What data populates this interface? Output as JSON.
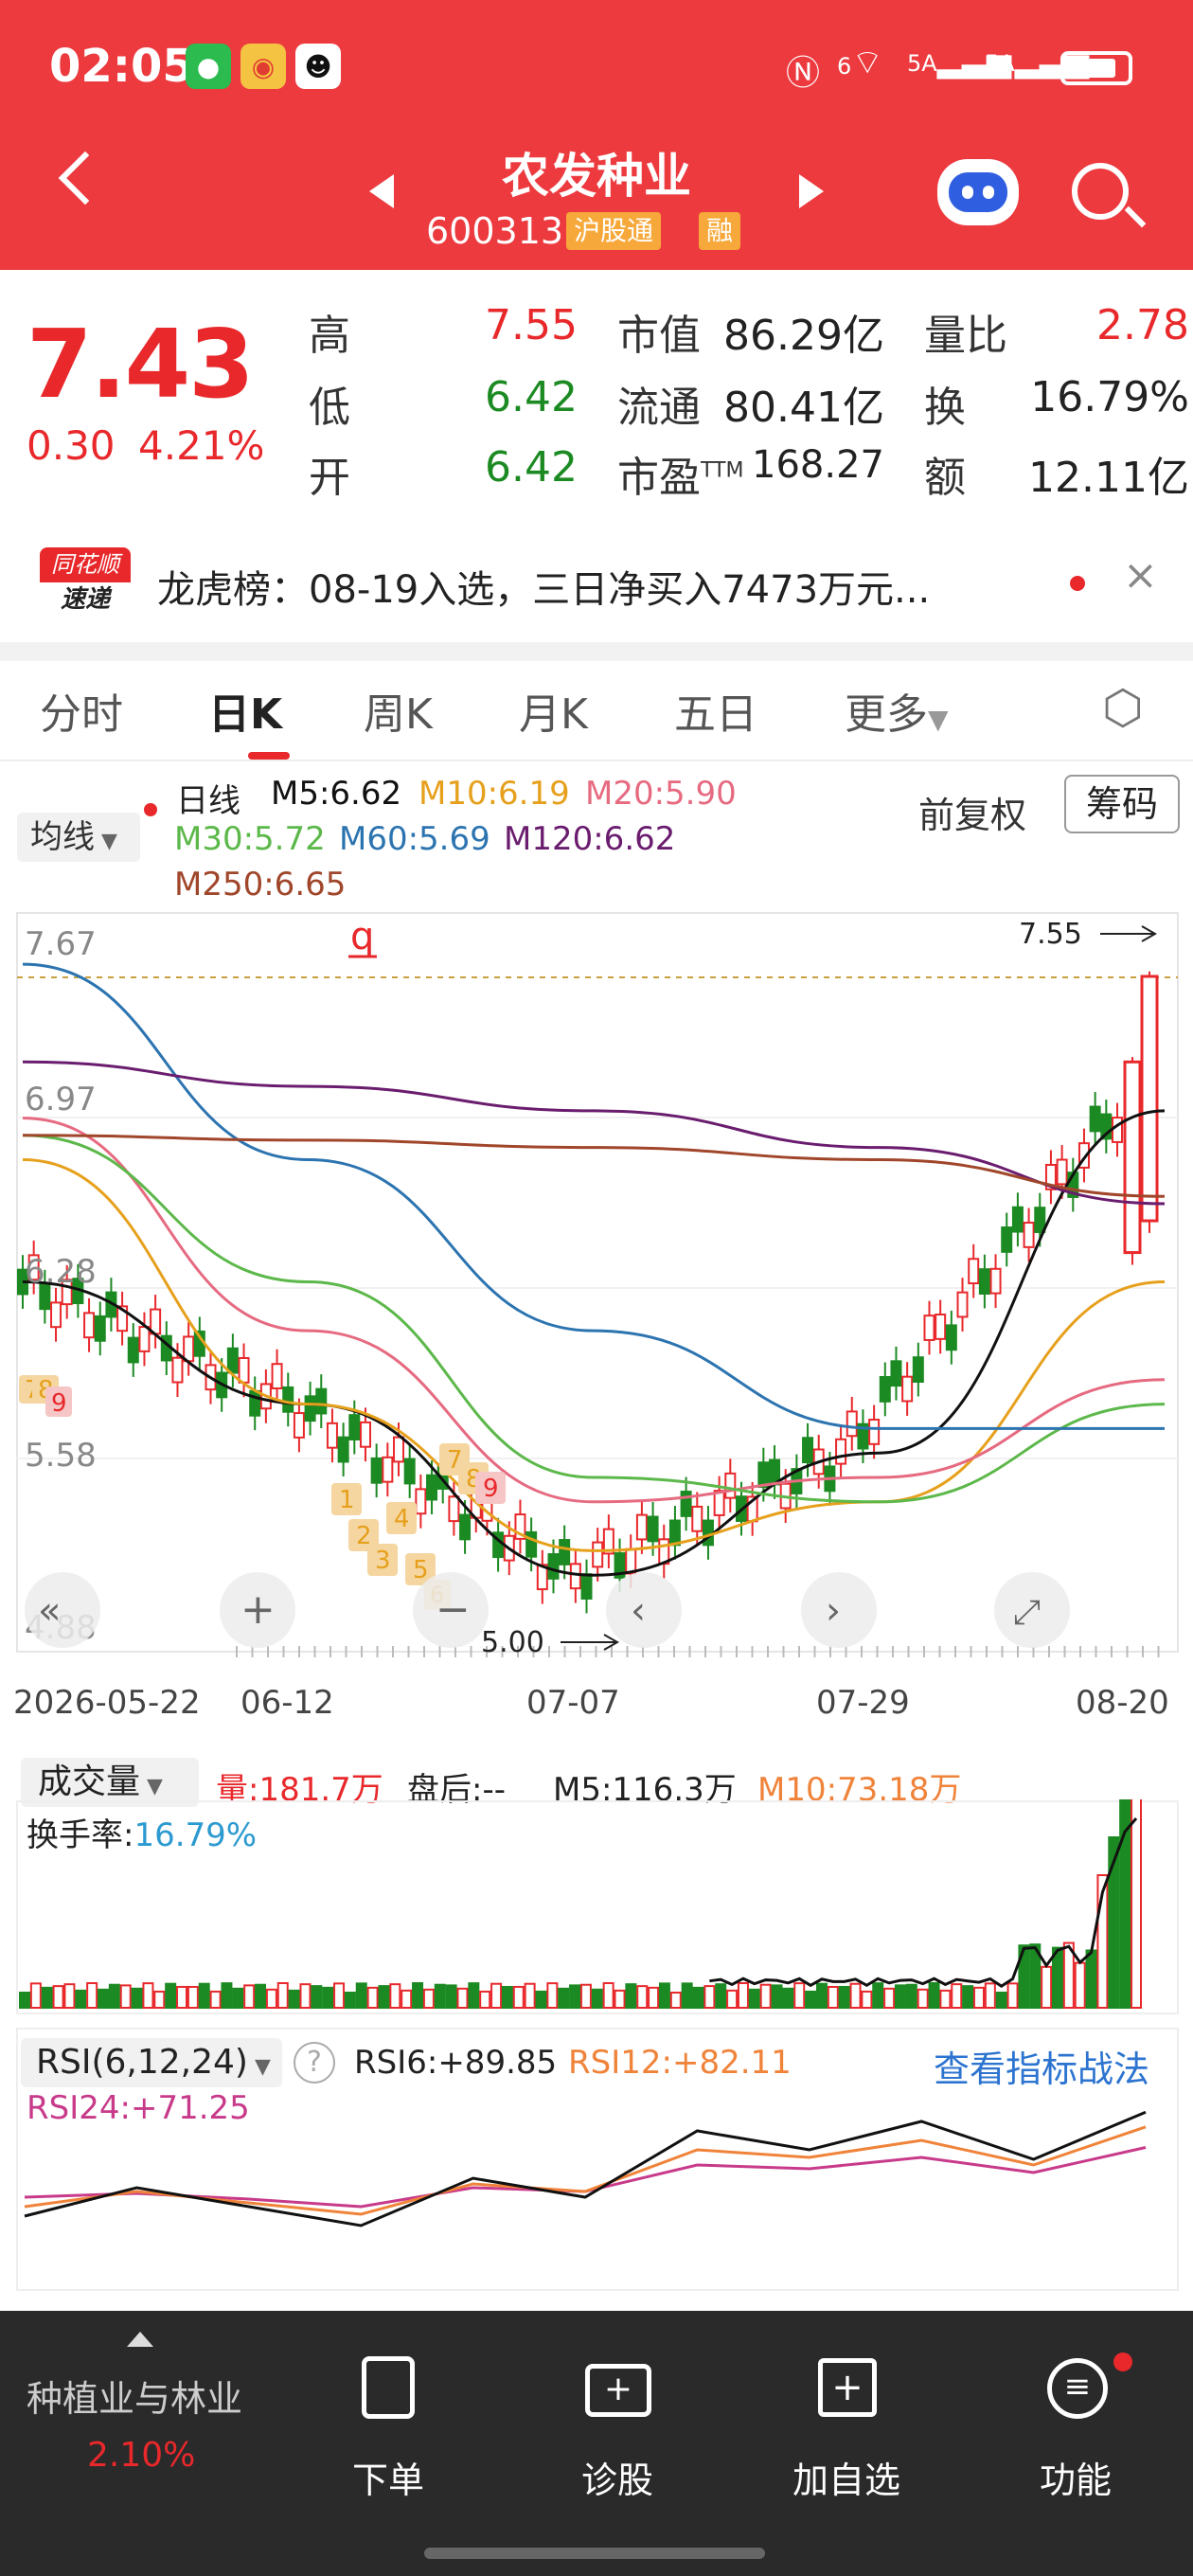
{
  "status_bar": {
    "time": "02:05",
    "wifi_label": "6",
    "signal1_label": "5A",
    "signal2_label": "5A"
  },
  "title_bar": {
    "name": "农发种业",
    "code": "600313",
    "tag1": "沪股通",
    "tag2": "融"
  },
  "quote": {
    "price": "7.43",
    "change": "0.30",
    "change_pct": "4.21%",
    "high_label": "高",
    "high": "7.55",
    "low_label": "低",
    "low": "6.42",
    "open_label": "开",
    "open": "6.42",
    "mktcap_label": "市值",
    "mktcap": "86.29亿",
    "float_label": "流通",
    "float": "80.41亿",
    "pe_label": "市盈",
    "pe_sup": "TTM",
    "pe": "168.27",
    "volratio_label": "量比",
    "volratio": "2.78",
    "turnover_label": "换",
    "turnover": "16.79%",
    "amount_label": "额",
    "amount": "12.11亿"
  },
  "news": {
    "logo_top": "同花顺",
    "logo_bottom": "速递",
    "text": "龙虎榜：08-19入选，三日净买入7473万元..."
  },
  "tabs": [
    "分时",
    "日K",
    "周K",
    "月K",
    "五日",
    "更多"
  ],
  "kline": {
    "ma_button": "均线",
    "ma_line1": {
      "day": "日线",
      "m5": "M5:6.62",
      "m10": "M10:6.19",
      "m20": "M20:5.90"
    },
    "ma_line2": {
      "m30": "M30:5.72",
      "m60": "M60:5.69",
      "m120": "M120:6.62"
    },
    "ma_line3": {
      "m250": "M250:6.65"
    },
    "adjust": "前复权",
    "chips": "筹码",
    "y_ticks": [
      "7.67",
      "6.97",
      "6.28",
      "5.58",
      "4.88"
    ],
    "high_mark": "7.55",
    "low_mark": "5.00",
    "dates": [
      "2026-05-22",
      "06-12",
      "07-07",
      "07-29",
      "08-20"
    ],
    "q_marker": "q",
    "td_labels_upper": [
      "7",
      "8",
      "9"
    ],
    "td_labels_lower": [
      "1",
      "2",
      "3",
      "4",
      "5",
      "6"
    ],
    "td_labels_left": [
      "7",
      "8",
      "9"
    ]
  },
  "volume": {
    "label": "成交量",
    "vol": "量:181.7万",
    "after": "盘后:-- ",
    "m5": "M5:116.3万",
    "m10": "M10:73.18万",
    "turnover_label": "换手率:",
    "turnover": "16.79%"
  },
  "rsi": {
    "label": "RSI(6,12,24)",
    "help": "?",
    "rsi6": "RSI6:+89.85",
    "rsi12": "RSI12:+82.11",
    "rsi24": "RSI24:+71.25",
    "link": "查看指标战法"
  },
  "bottom": {
    "sector": "种植业与林业",
    "sector_pct": "2.10%",
    "items": [
      "下单",
      "诊股",
      "加自选",
      "功能"
    ]
  },
  "colors": {
    "header": "#ec3a3f",
    "up": "#e8282b",
    "down": "#1c8a22",
    "m5": "#111111",
    "m10": "#e6a01c",
    "m20": "#e66a80",
    "m30": "#5cb84a",
    "m60": "#2c74b0",
    "m120": "#6a1c6e",
    "m250": "#a0462a"
  },
  "chart_data": [
    {
      "type": "line",
      "title": "",
      "x": [
        "2026-05-22",
        "06-12",
        "07-07",
        "07-29",
        "08-20"
      ],
      "ylim": [
        4.88,
        7.67
      ],
      "series": [
        {
          "name": "M5",
          "values": [
            6.3,
            5.8,
            5.1,
            5.6,
            7.0
          ]
        },
        {
          "name": "M10",
          "values": [
            6.8,
            5.8,
            5.2,
            5.4,
            6.3
          ]
        },
        {
          "name": "M20",
          "values": [
            6.97,
            6.1,
            5.4,
            5.5,
            5.9
          ]
        },
        {
          "name": "M30",
          "values": [
            6.9,
            6.3,
            5.5,
            5.4,
            5.8
          ]
        },
        {
          "name": "M60",
          "values": [
            7.6,
            6.8,
            6.1,
            5.7,
            5.7
          ]
        },
        {
          "name": "M120",
          "values": [
            7.2,
            7.1,
            7.0,
            6.85,
            6.62
          ]
        },
        {
          "name": "M250",
          "values": [
            6.9,
            6.88,
            6.85,
            6.8,
            6.65
          ]
        }
      ]
    },
    {
      "type": "line",
      "title": "",
      "series": [
        {
          "name": "RSI6",
          "values": [
            35,
            50,
            40,
            30,
            55,
            45,
            80,
            70,
            85,
            65,
            89.85
          ]
        },
        {
          "name": "RSI12",
          "values": [
            40,
            48,
            42,
            36,
            52,
            48,
            70,
            66,
            75,
            62,
            82.11
          ]
        },
        {
          "name": "RSI24",
          "values": [
            45,
            47,
            44,
            40,
            50,
            48,
            62,
            60,
            66,
            58,
            71.25
          ]
        }
      ]
    }
  ]
}
